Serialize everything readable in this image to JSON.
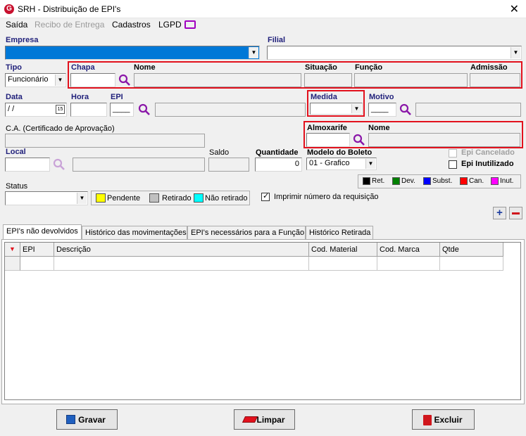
{
  "window": {
    "title": "SRH - Distribuição de EPI's",
    "logo_letter": "G"
  },
  "menu": [
    "Saída",
    "Recibo de Entrega",
    "Cadastros",
    "LGPD"
  ],
  "labels": {
    "empresa": "Empresa",
    "filial": "Filial",
    "tipo": "Tipo",
    "chapa": "Chapa",
    "nome": "Nome",
    "situacao": "Situação",
    "funcao": "Função",
    "admissao": "Admissão",
    "data": "Data",
    "hora": "Hora",
    "epi": "EPI",
    "medida": "Medida",
    "motivo": "Motivo",
    "ca": "C.A. (Certificado de Aprovação)",
    "almoxarife": "Almoxarife",
    "nome_almox": "Nome",
    "local": "Local",
    "saldo": "Saldo",
    "quantidade": "Quantidade",
    "modelo_boleto": "Modelo do Boleto",
    "epi_cancelado": "Epi Cancelado",
    "epi_inutilizado": "Epi Inutilizado",
    "status": "Status",
    "imprimir": "Imprimir número da requisição"
  },
  "values": {
    "tipo": "Funcionário",
    "data": " /  /",
    "quantidade": "0",
    "modelo_boleto": "01 - Grafico",
    "epi_code": "____",
    "motivo_code": "____"
  },
  "status_legend": [
    "Pendente",
    "Retirado",
    "Não retirado"
  ],
  "legend": [
    {
      "label": "Ret.",
      "color": "#000000"
    },
    {
      "label": "Dev.",
      "color": "#008000"
    },
    {
      "label": "Subst.",
      "color": "#0000ff"
    },
    {
      "label": "Can.",
      "color": "#ff0000"
    },
    {
      "label": "Inut.",
      "color": "#ff00ff"
    }
  ],
  "tabs": [
    "EPI's não devolvidos",
    "Histórico das movimentações",
    "EPI's necessários para a Função",
    "Histórico Retirada"
  ],
  "grid": {
    "columns": [
      "EPI",
      "Descrição",
      "Cod. Material",
      "Cod. Marca",
      "Qtde"
    ]
  },
  "buttons": {
    "gravar": "Gravar",
    "limpar": "Limpar",
    "excluir": "Excluir"
  },
  "colors": {
    "highlight": "#e2111d",
    "label_blue": "#1f1f7a",
    "empresa_selection": "#0078d7"
  }
}
